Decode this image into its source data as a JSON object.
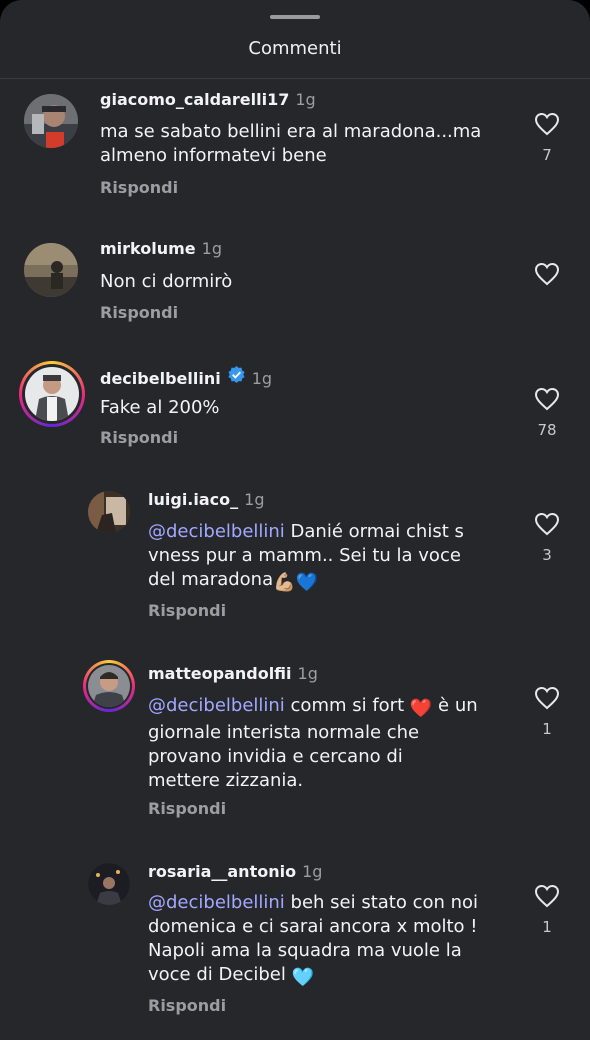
{
  "sheet": {
    "title": "Commenti"
  },
  "comments": [
    {
      "username": "giacomo_caldarelli17",
      "time": "1g",
      "text": "ma se sabato bellini era al maradona...ma almeno informatevi bene",
      "text_line1": "ma se sabato bellini era al maradona...ma",
      "text_line2": "almeno informatevi bene",
      "reply": "Rispondi",
      "likes": "7"
    },
    {
      "username": "mirkolume",
      "time": "1g",
      "text": "Non ci dormirò",
      "reply": "Rispondi",
      "likes": ""
    },
    {
      "username": "decibelbellini",
      "time": "1g",
      "verified": true,
      "text": "Fake al 200%",
      "reply": "Rispondi",
      "likes": "78"
    }
  ],
  "replies": [
    {
      "username": "luigi.iaco_",
      "time": "1g",
      "mention": "@decibelbellini",
      "text_line1": " Danié ormai chist s",
      "text_line2": "vness pur a mamm.. Sei tu la voce",
      "text_line3": "del maradona",
      "emoji": "💪🏼💙",
      "reply": "Rispondi",
      "likes": "3"
    },
    {
      "username": "matteopandolfii",
      "time": "1g",
      "mention": "@decibelbellini",
      "text_line1": " comm si fort ",
      "emoji": "❤️",
      "text_line1b": " è un",
      "text_line2": "giornale interista normale che",
      "text_line3": "provano invidia e cercano di",
      "text_line4": "mettere zizzania.",
      "reply": "Rispondi",
      "likes": "1"
    },
    {
      "username": "rosaria__antonio",
      "time": "1g",
      "mention": "@decibelbellini",
      "text_line1": " beh sei stato con noi",
      "text_line2": "domenica e ci sarai ancora x molto !",
      "text_line3": "Napoli ama la squadra ma vuole la",
      "text_line4": "voce di Decibel ",
      "emoji": "🩵",
      "reply": "Rispondi",
      "likes": "1"
    }
  ],
  "icons": {
    "heart": "heart-outline-icon",
    "verified": "verified-badge-icon"
  },
  "colors": {
    "background": "#26272b",
    "mention": "#a2a8ff",
    "verified": "#3797f0",
    "muted": "#9c9da3"
  }
}
